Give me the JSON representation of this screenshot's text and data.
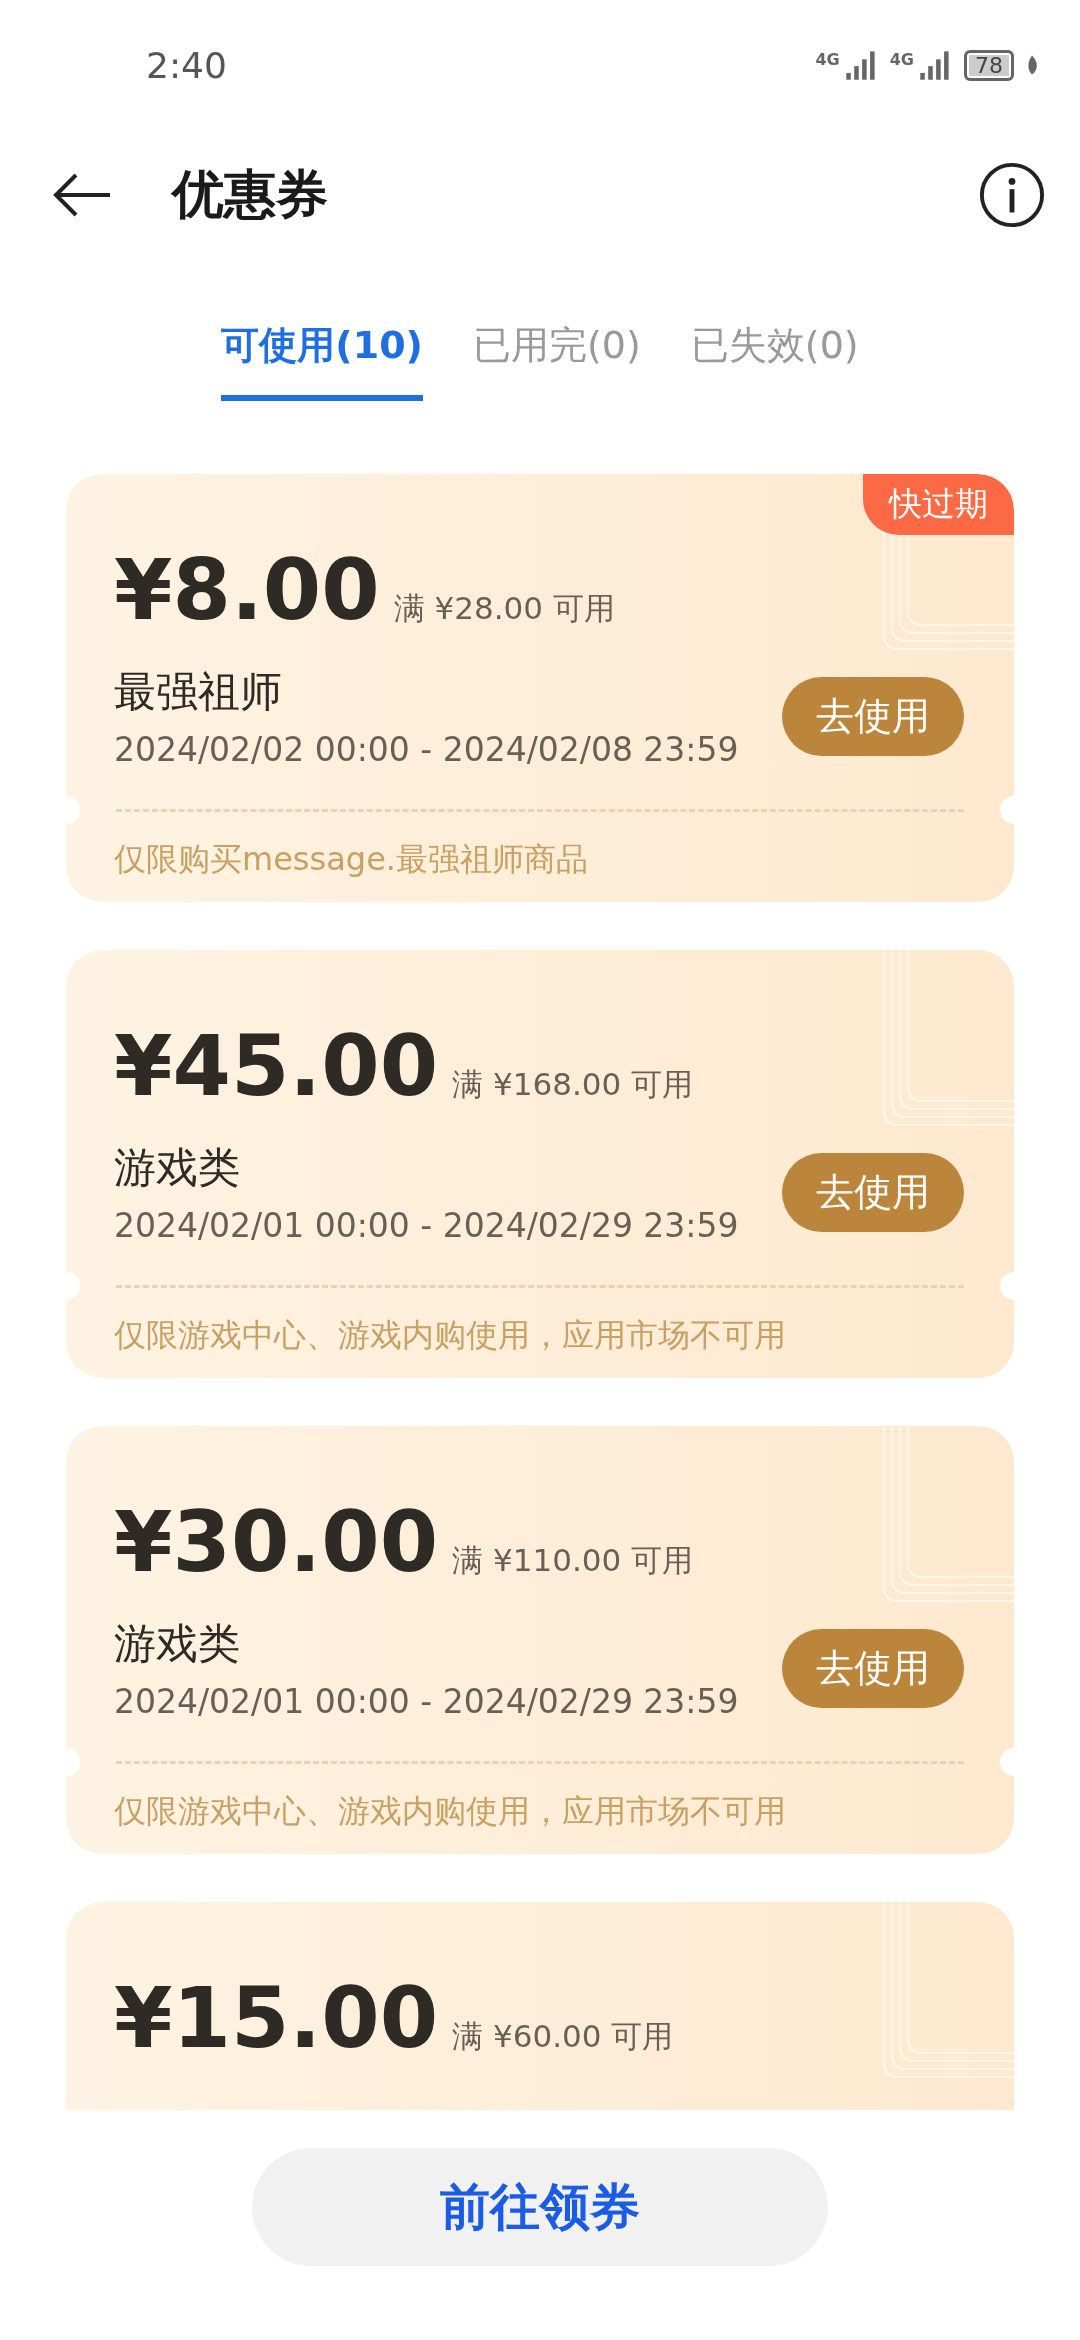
{
  "status_bar": {
    "time": "2:40",
    "network_1": "4G",
    "network_2": "4G",
    "battery": "78"
  },
  "header": {
    "title": "优惠券"
  },
  "tabs": [
    {
      "label": "可使用(10)",
      "selected": true
    },
    {
      "label": "已用完(0)",
      "selected": false
    },
    {
      "label": "已失效(0)",
      "selected": false
    }
  ],
  "coupons": [
    {
      "amount": "¥8.00",
      "condition": "满 ¥28.00 可用",
      "badge": "快过期",
      "title": "最强祖师",
      "period": "2024/02/02 00:00 - 2024/02/08 23:59",
      "button": "去使用",
      "restriction": "仅限购买message.最强祖师商品"
    },
    {
      "amount": "¥45.00",
      "condition": "满 ¥168.00 可用",
      "title": "游戏类",
      "period": "2024/02/01 00:00 - 2024/02/29 23:59",
      "button": "去使用",
      "restriction": "仅限游戏中心、游戏内购使用，应用市场不可用"
    },
    {
      "amount": "¥30.00",
      "condition": "满 ¥110.00 可用",
      "title": "游戏类",
      "period": "2024/02/01 00:00 - 2024/02/29 23:59",
      "button": "去使用",
      "restriction": "仅限游戏中心、游戏内购使用，应用市场不可用"
    },
    {
      "amount": "¥15.00",
      "condition": "满 ¥60.00 可用"
    }
  ],
  "bottom_button": "前往领券"
}
